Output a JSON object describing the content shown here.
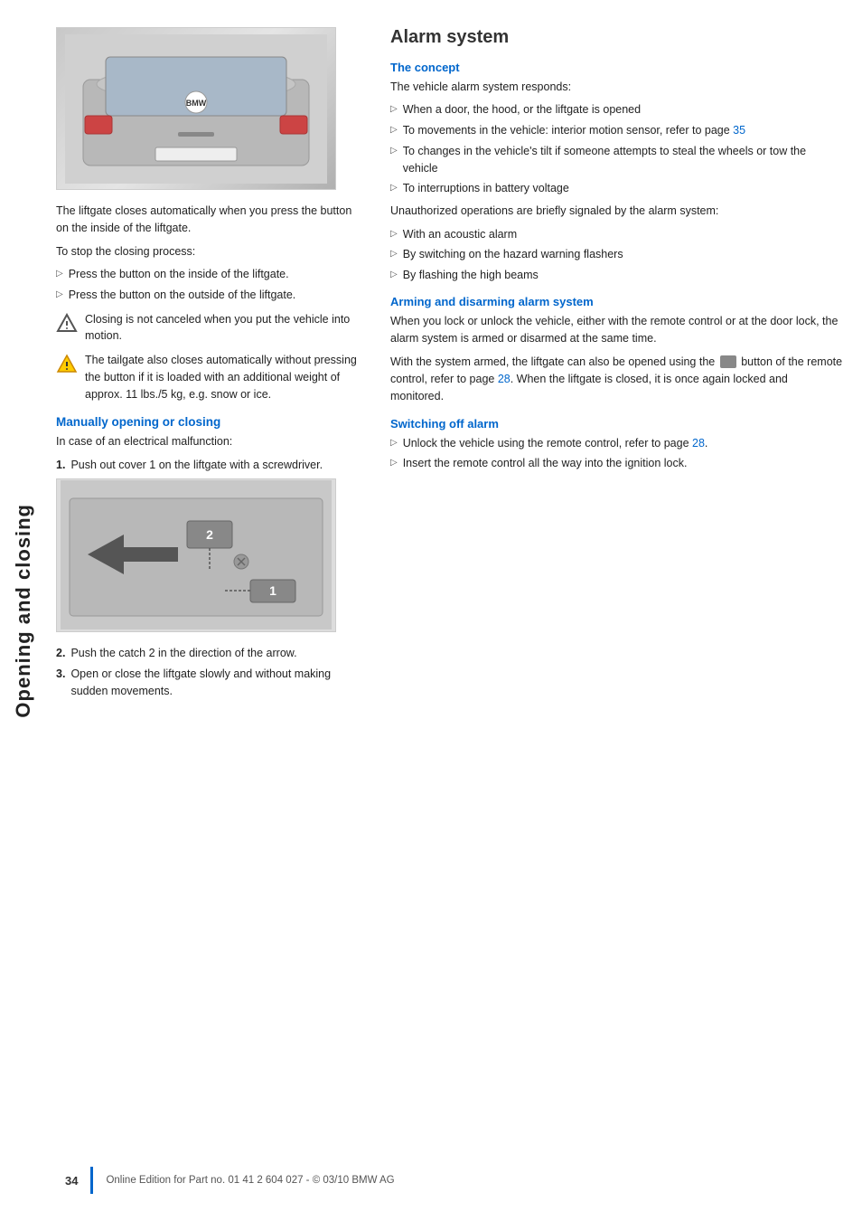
{
  "sidebar": {
    "label": "Opening and closing"
  },
  "left": {
    "intro_text": "The liftgate closes automatically when you press the button on the inside of the liftgate.",
    "stop_label": "To stop the closing process:",
    "stop_bullets": [
      "Press the button on the inside of the liftgate.",
      "Press the button on the outside of the liftgate."
    ],
    "note1": "Closing is not canceled when you put the vehicle into motion.",
    "warning1": "The tailgate also closes automatically without pressing the button if it is loaded with an additional weight of approx. 11 lbs./5 kg, e.g. snow or ice.",
    "manual_heading": "Manually opening or closing",
    "manual_intro": "In case of an electrical malfunction:",
    "manual_steps": [
      {
        "num": "1.",
        "text": "Push out cover 1 on the liftgate with a screwdriver."
      },
      {
        "num": "2.",
        "text": "Push the catch 2 in the direction of the arrow."
      },
      {
        "num": "3.",
        "text": "Open or close the liftgate slowly and without making sudden movements."
      }
    ]
  },
  "right": {
    "section_title": "Alarm system",
    "concept_heading": "The concept",
    "concept_intro": "The vehicle alarm system responds:",
    "concept_bullets": [
      "When a door, the hood, or the liftgate is opened",
      "To movements in the vehicle: interior motion sensor, refer to page 35",
      "To changes in the vehicle's tilt if someone attempts to steal the wheels or tow the vehicle",
      "To interruptions in battery voltage"
    ],
    "unauthorized_text": "Unauthorized operations are briefly signaled by the alarm system:",
    "unauthorized_bullets": [
      "With an acoustic alarm",
      "By switching on the hazard warning flashers",
      "By flashing the high beams"
    ],
    "arming_heading": "Arming and disarming alarm system",
    "arming_text1": "When you lock or unlock the vehicle, either with the remote control or at the door lock, the alarm system is armed or disarmed at the same time.",
    "arming_text2": "With the system armed, the liftgate can also be opened using the  button of the remote control, refer to page 28. When the liftgate is closed, it is once again locked and monitored.",
    "switching_heading": "Switching off alarm",
    "switching_bullets": [
      "Unlock the vehicle using the remote control, refer to page 28.",
      "Insert the remote control all the way into the ignition lock."
    ]
  },
  "footer": {
    "page_number": "34",
    "footer_text": "Online Edition for Part no. 01 41 2 604 027 - © 03/10 BMW AG"
  }
}
